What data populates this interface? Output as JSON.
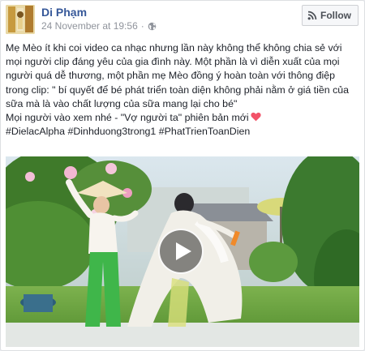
{
  "post": {
    "author": "Di Phạm",
    "timestamp": "24 November at 19:56",
    "separator": "·",
    "privacy_icon": "globe-icon",
    "follow_label": "Follow",
    "follow_icon": "rss-icon"
  },
  "body": {
    "paragraph1": "Mẹ Mèo ít khi coi video ca nhạc nhưng lần này không thể không chia sẻ với mọi người clip đáng yêu của gia đình này. Một phần là vì diễn xuất của mọi người quá dễ thương, một phần mẹ Mèo đồng ý hoàn toàn với thông điệp trong clip: \" bí quyết để bé phát triển toàn diện không phải nằm ở giá tiền của sữa mà là vào chất lượng của sữa mang lại cho bé\"",
    "paragraph2": "Mọi người vào xem nhé - \"Vợ người ta\" phiên bản mới",
    "heart_icon": "heart-icon",
    "hashtags": [
      "#DielacAlpha",
      "#Dinhduong3trong1",
      "#PhatTrienToanDien"
    ]
  },
  "video": {
    "play_icon": "play-icon"
  },
  "colors": {
    "link": "#365899",
    "meta": "#90949c",
    "text": "#1d2129",
    "heart": "#f25268"
  }
}
